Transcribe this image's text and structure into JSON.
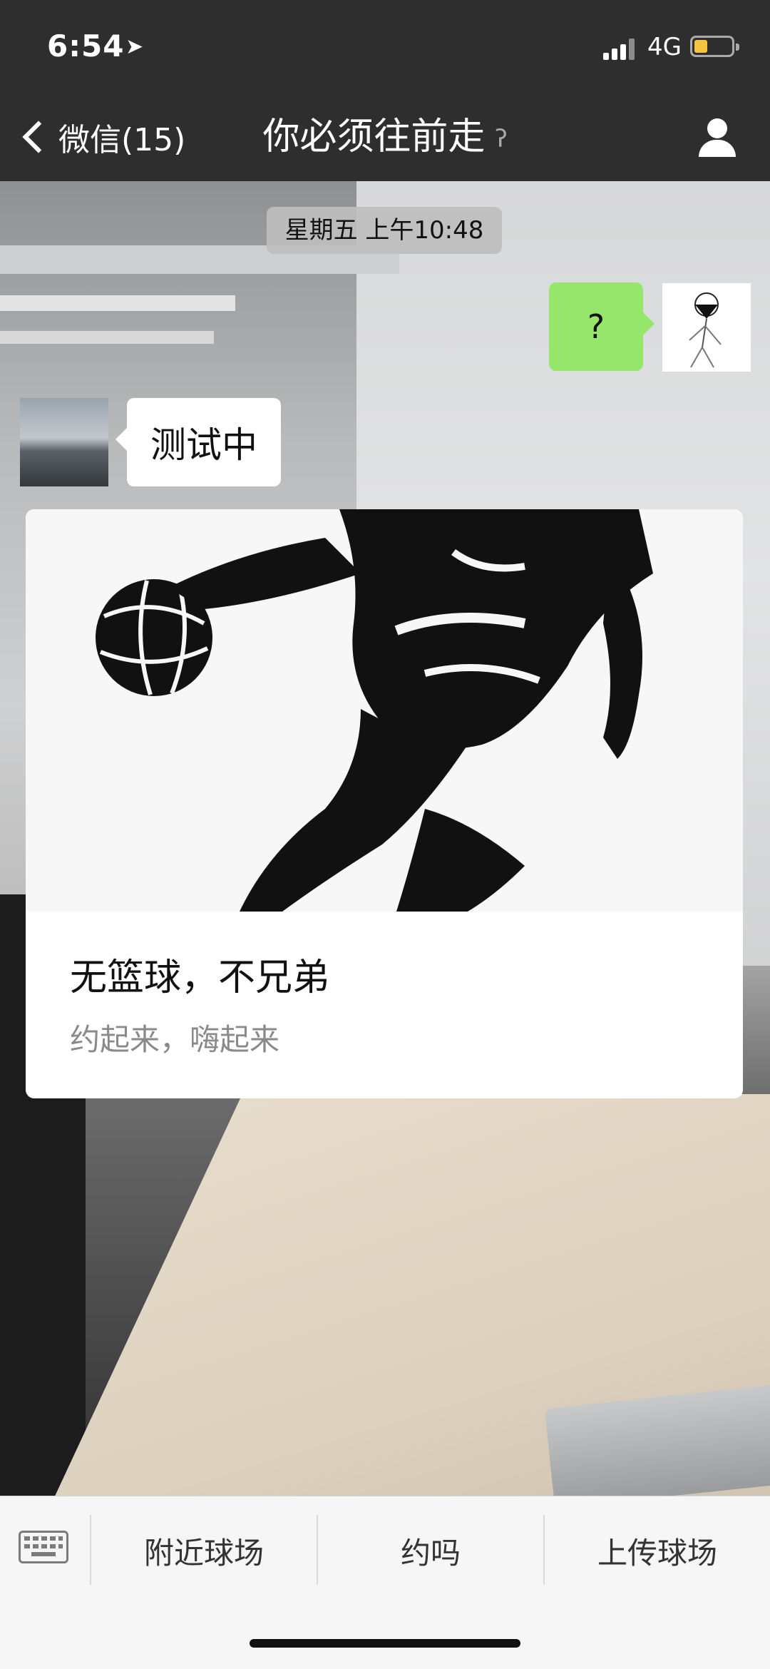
{
  "status": {
    "time": "6:54",
    "location_icon": "location-arrow-icon",
    "network": "4G",
    "battery_color": "#f5c542"
  },
  "nav": {
    "back_label": "微信(15)",
    "title": "你必须往前走",
    "ear_icon": "ear-icon",
    "profile_icon": "person-icon"
  },
  "chat": {
    "timestamp": "星期五 上午10:48",
    "messages": [
      {
        "side": "right",
        "text": "?",
        "bubble_color": "#95e66a"
      },
      {
        "side": "left",
        "text": "测试中",
        "bubble_color": "#ffffff"
      }
    ]
  },
  "card": {
    "title": "无篮球，不兄弟",
    "subtitle": "约起来，嗨起来",
    "image": "basketball-player-silhouette"
  },
  "bottom_menu": {
    "items": [
      "附近球场",
      "约吗",
      "上传球场"
    ],
    "keyboard_icon": "keyboard-icon"
  }
}
